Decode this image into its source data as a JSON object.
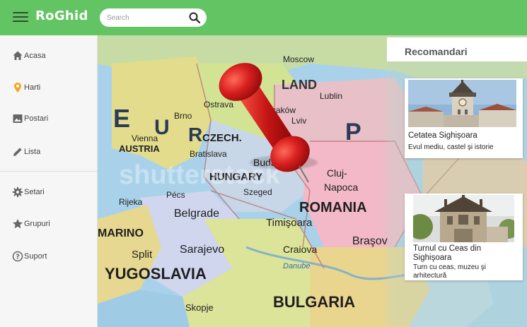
{
  "app": {
    "brand": "RoGhid"
  },
  "search": {
    "placeholder": "Search",
    "value": ""
  },
  "sidebar": {
    "items": [
      {
        "label": "Acasa",
        "icon": "home-icon"
      },
      {
        "label": "Harti",
        "icon": "map-pin-icon"
      },
      {
        "label": "Postari",
        "icon": "image-icon"
      },
      {
        "label": "Lista",
        "icon": "pencil-icon"
      }
    ],
    "secondary": [
      {
        "label": "Setari",
        "icon": "gear-icon"
      },
      {
        "label": "Grupuri",
        "icon": "star-icon"
      },
      {
        "label": "Suport",
        "icon": "help-icon"
      }
    ]
  },
  "map": {
    "labels": [
      "E",
      "U",
      "R",
      "P",
      "POLAND",
      "LAND",
      "Ostrava",
      "Brno",
      "CZECH.",
      "Vienna",
      "AUSTRIA",
      "Bratislava",
      "Budapest",
      "HUNGARY",
      "Pécs",
      "Szeged",
      "Cluj-Napoca",
      "ROMANIA",
      "Rijeka",
      "Belgrade",
      "Timişoara",
      "MARINO",
      "Split",
      "Sarajevo",
      "Craiova",
      "Braşov",
      "Danube",
      "YUGOSLAVIA",
      "BULGARIA",
      "Skopje",
      "Lublin",
      "Kraków",
      "Lviv",
      "Moscow",
      "shutterstock"
    ]
  },
  "recommendations": {
    "title": "Recomandari",
    "cards": [
      {
        "title": "Cetatea Sighişoara",
        "subtitle": "Evul mediu, castel şi istorie",
        "image": "clock-tower-photo"
      },
      {
        "title": "Turnul cu Ceas din Sighişoara",
        "subtitle": "Turn cu ceas, muzeu şi arhitectură",
        "image": "clock-tower-photo"
      }
    ]
  },
  "colors": {
    "accent": "#62c462",
    "sidebar_bg": "#f6f6f6",
    "pin": "#d41f1f",
    "icon_orange": "#f5a623",
    "icon_gray": "#666666"
  }
}
